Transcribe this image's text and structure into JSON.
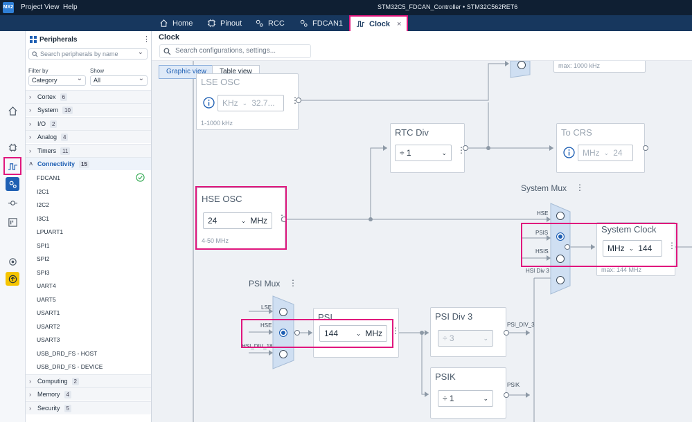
{
  "app": {
    "logo_text": "MX2",
    "menu": [
      "Project",
      "View",
      "Help"
    ],
    "project_title": "STM32C5_FDCAN_Controller  •  STM32C562RET6"
  },
  "tabs": [
    {
      "label": "Home",
      "icon": "home-icon"
    },
    {
      "label": "Pinout",
      "icon": "chip-icon"
    },
    {
      "label": "RCC",
      "icon": "gears-icon"
    },
    {
      "label": "FDCAN1",
      "icon": "gears-icon"
    },
    {
      "label": "Clock",
      "icon": "clock-wave-icon",
      "active": true,
      "close": "×"
    }
  ],
  "sidebar": {
    "title": "Peripherals",
    "search_placeholder": "Search peripherals by name",
    "filter_label": "Filter by",
    "filter_value": "Category",
    "show_label": "Show",
    "show_value": "All",
    "categories_top": [
      {
        "name": "Cortex",
        "count": "6"
      },
      {
        "name": "System",
        "count": "10"
      },
      {
        "name": "I/O",
        "count": "2"
      },
      {
        "name": "Analog",
        "count": "4"
      },
      {
        "name": "Timers",
        "count": "11"
      },
      {
        "name": "Connectivity",
        "count": "15"
      }
    ],
    "connectivity_items": [
      "FDCAN1",
      "I2C1",
      "I2C2",
      "I3C1",
      "LPUART1",
      "SPI1",
      "SPI2",
      "SPI3",
      "UART4",
      "UART5",
      "USART1",
      "USART2",
      "USART3",
      "USB_DRD_FS - HOST",
      "USB_DRD_FS - DEVICE"
    ],
    "categories_bottom": [
      {
        "name": "Computing",
        "count": "2"
      },
      {
        "name": "Memory",
        "count": "4"
      },
      {
        "name": "Security",
        "count": "5"
      }
    ]
  },
  "main": {
    "title": "Clock",
    "search_placeholder": "Search configurations, settings...",
    "view_buttons": [
      "Graphic view",
      "Table view"
    ]
  },
  "clock": {
    "top_partial": "max: 1000 kHz",
    "lse": {
      "title": "LSE OSC",
      "unit": "KHz",
      "value": "32.7...",
      "range": "1-1000 kHz"
    },
    "rtc": {
      "title": "RTC Div",
      "value": "÷ 1"
    },
    "crs": {
      "title": "To CRS",
      "unit": "MHz",
      "value": "24"
    },
    "hse": {
      "title": "HSE OSC",
      "value": "24",
      "unit": "MHz",
      "range": "4-50 MHz"
    },
    "system_mux": {
      "title": "System Mux",
      "inputs": [
        "HSE",
        "PSIS",
        "HSIS",
        "HSI Div 3"
      ]
    },
    "system_clock": {
      "title": "System Clock",
      "unit": "MHz",
      "value": "144",
      "max": "max: 144 MHz"
    },
    "psi_mux": {
      "title": "PSI Mux",
      "inputs": [
        "LSE",
        "HSE",
        "HSI_DIV_18"
      ]
    },
    "psi": {
      "title": "PSI",
      "value": "144",
      "unit": "MHz"
    },
    "psi_div3": {
      "title": "PSI Div 3",
      "value": "÷ 3",
      "out": "PSI_DIV_3"
    },
    "psik": {
      "title": "PSIK",
      "value": "÷ 1",
      "out": "PSIK"
    }
  },
  "colors": {
    "highlight": "#e0167d",
    "accent": "#1e5fb3",
    "titlebar": "#0f1f33",
    "tabbar": "#17375e"
  }
}
